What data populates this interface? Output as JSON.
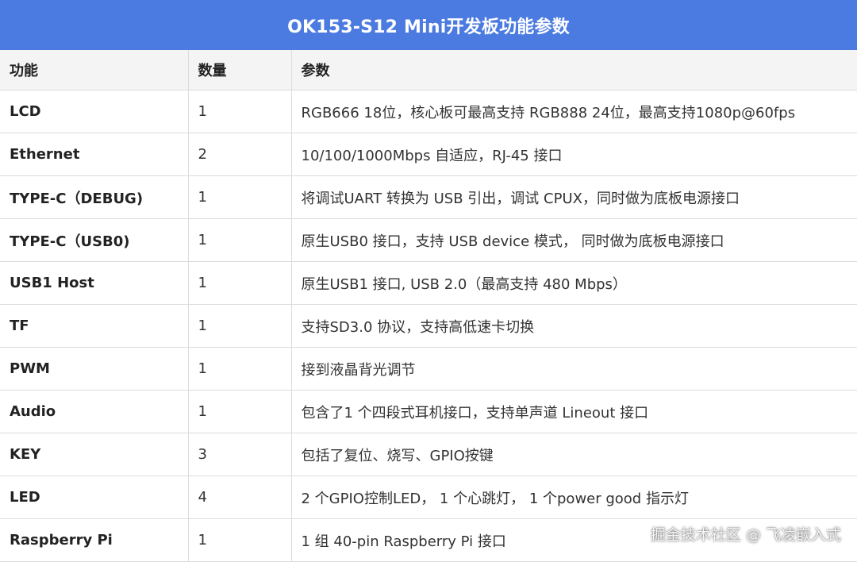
{
  "title": "OK153-S12 Mini开发板功能参数",
  "table": {
    "headers": [
      "功能",
      "数量",
      "参数"
    ],
    "rows": [
      {
        "feature": "LCD",
        "qty": "1",
        "param": "RGB666 18位，核心板可最高支持 RGB888 24位，最高支持1080p@60fps"
      },
      {
        "feature": "Ethernet",
        "qty": "2",
        "param": "10/100/1000Mbps 自适应，RJ-45 接口"
      },
      {
        "feature": "TYPE-C（DEBUG)",
        "qty": "1",
        "param": "将调试UART 转换为 USB 引出，调试 CPUX，同时做为底板电源接口"
      },
      {
        "feature": "TYPE-C（USB0)",
        "qty": "1",
        "param": "原生USB0 接口，支持 USB device 模式， 同时做为底板电源接口"
      },
      {
        "feature": "USB1 Host",
        "qty": "1",
        "param": "原生USB1 接口, USB 2.0（最高支持 480 Mbps）"
      },
      {
        "feature": "TF",
        "qty": "1",
        "param": "支持SD3.0 协议，支持高低速卡切换"
      },
      {
        "feature": "PWM",
        "qty": "1",
        "param": "接到液晶背光调节"
      },
      {
        "feature": "Audio",
        "qty": "1",
        "param": "包含了1 个四段式耳机接口，支持单声道 Lineout 接口"
      },
      {
        "feature": "KEY",
        "qty": "3",
        "param": "包括了复位、烧写、GPIO按键"
      },
      {
        "feature": "LED",
        "qty": "4",
        "param": "2 个GPIO控制LED， 1 个心跳灯， 1 个power good 指示灯"
      },
      {
        "feature": "Raspberry Pi",
        "qty": "1",
        "param": "1 组 40-pin Raspberry Pi 接口"
      }
    ]
  },
  "watermark": "掘金技术社区 @ 飞凌嵌入式",
  "colors": {
    "title_bg": "#4b7be0",
    "header_bg": "#f4f4f4"
  }
}
